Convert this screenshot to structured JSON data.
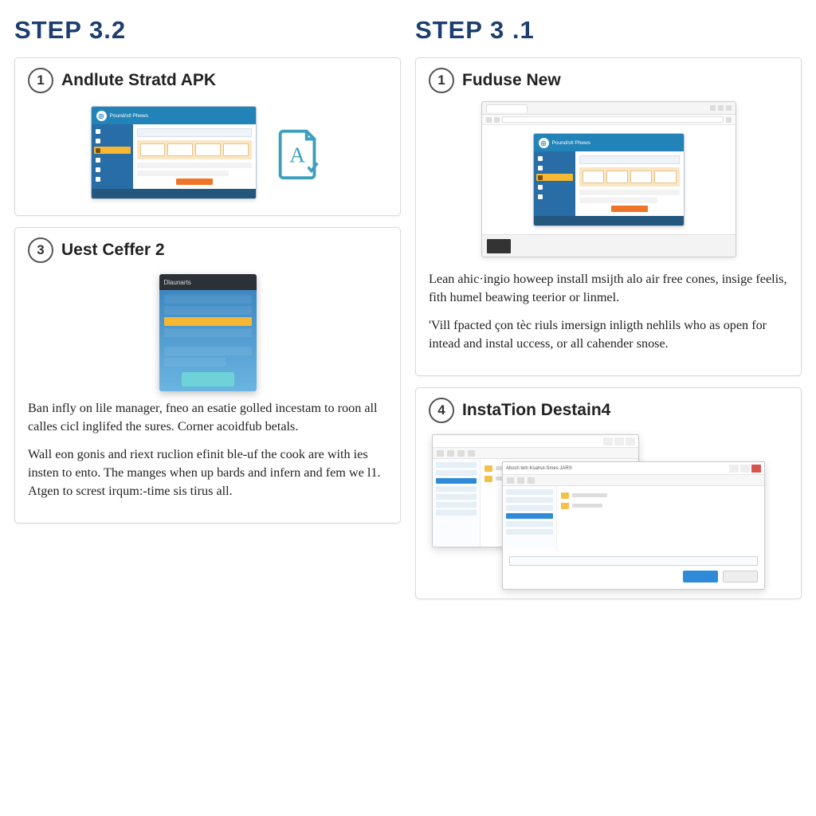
{
  "left": {
    "header": "STEP 3.2",
    "card1": {
      "num": "1",
      "title": "Andlute Stratd APK"
    },
    "card3": {
      "num": "3",
      "title": "Uest Ceffer 2",
      "phone_header": "Dlaunarts",
      "p1": "Ban infly on lile manager, fneo an esatie golled incestam to roon all calles cicl inglifed the sures. Corner acoidfub betals.",
      "p2": "Wall eon gonis and riext ruclion efinit ble-uf the cook are with ies insten to ento. The manges when up bards and infern and fem we l1. Atgen to screst irqum:-time sis tirus all."
    }
  },
  "right": {
    "header": "STEP 3 .1",
    "card1": {
      "num": "1",
      "title": "Fuduse New",
      "p1": "Lean ahic·ingio howeep install msijth alo air free cones, insige feelis, fìth humel beawing teerior or linmel.",
      "p2": "'Vill fpacted çon tèc riuls imersign inligth nehlils who as open for intead and instal uccess, or all cahender snose."
    },
    "card4": {
      "num": "4",
      "title": "InstaTion Destain4"
    }
  },
  "dash_title": "Pound/stl  Phews",
  "explorer_title": "Absch teln Ksahut-Smes JARS"
}
